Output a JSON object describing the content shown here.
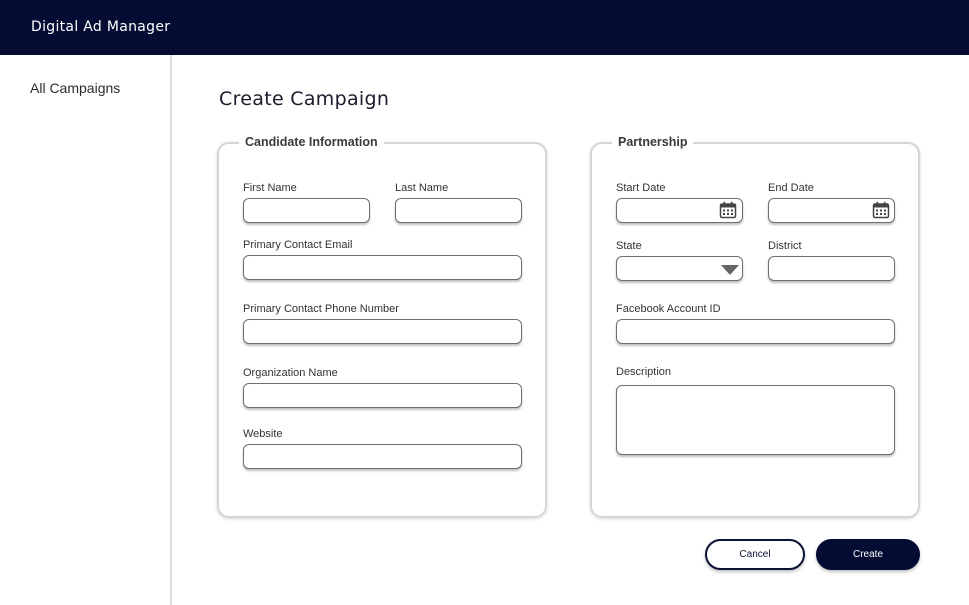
{
  "app": {
    "title": "Digital Ad Manager"
  },
  "sidebar": {
    "items": [
      {
        "label": "All Campaigns"
      }
    ]
  },
  "page": {
    "title": "Create Campaign"
  },
  "candidate": {
    "legend": "Candidate Information",
    "first_name": {
      "label": "First Name",
      "value": ""
    },
    "last_name": {
      "label": "Last Name",
      "value": ""
    },
    "email": {
      "label": "Primary Contact Email",
      "value": ""
    },
    "phone": {
      "label": "Primary Contact Phone Number",
      "value": ""
    },
    "organization": {
      "label": "Organization Name",
      "value": ""
    },
    "website": {
      "label": "Website",
      "value": ""
    }
  },
  "partnership": {
    "legend": "Partnership",
    "start_date": {
      "label": "Start Date",
      "value": ""
    },
    "end_date": {
      "label": "End Date",
      "value": ""
    },
    "state": {
      "label": "State",
      "value": ""
    },
    "district": {
      "label": "District",
      "value": ""
    },
    "facebook_id": {
      "label": "Facebook Account ID",
      "value": ""
    },
    "description": {
      "label": "Description",
      "value": ""
    }
  },
  "actions": {
    "cancel_label": "Cancel",
    "create_label": "Create"
  },
  "colors": {
    "brand_navy": "#050c33",
    "border": "#6e6e78",
    "panel_border": "#d4d4dc"
  },
  "icons": [
    "calendar-icon",
    "dropdown-arrow-icon"
  ]
}
